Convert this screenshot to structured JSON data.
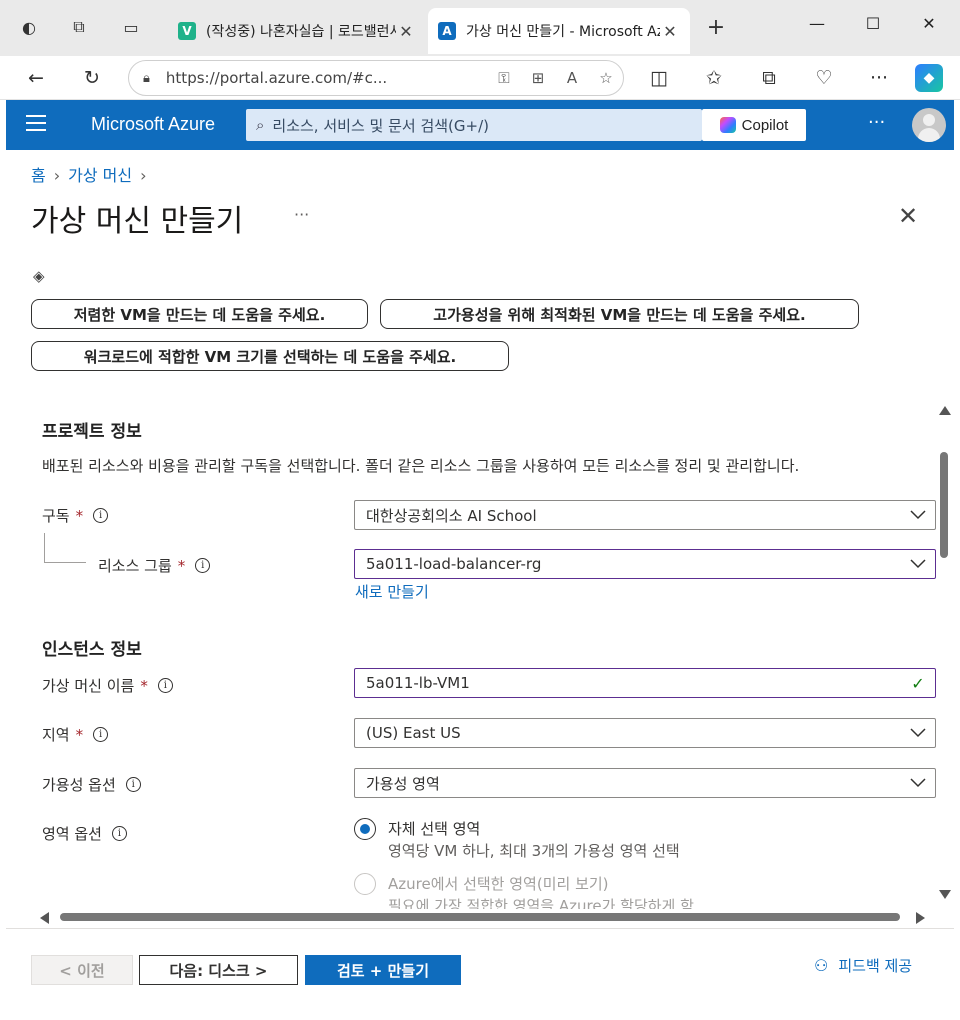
{
  "browser": {
    "tabs": [
      {
        "title": "(작성중) 나혼자실습 | 로드밸런서",
        "favicon": "V",
        "favicon_color": "#1fb28a",
        "active": false
      },
      {
        "title": "가상 머신 만들기 - Microsoft Azure",
        "favicon": "A",
        "favicon_color": "#0f6cbd",
        "active": true
      }
    ],
    "url": "https://portal.azure.com/#c...",
    "new_tab": "+",
    "controls": {
      "minimize": "—",
      "maximize": "☐",
      "close": "✕"
    }
  },
  "azure": {
    "brand": "Microsoft Azure",
    "search_placeholder": "리소스, 서비스 및 문서 검색(G+/)",
    "copilot_label": "Copilot",
    "more": "···"
  },
  "breadcrumb": [
    "홈",
    "가상 머신"
  ],
  "page": {
    "title": "가상 머신 만들기",
    "more": "···",
    "close": "✕"
  },
  "suggestions": [
    "저렴한 VM을 만드는 데 도움을 주세요.",
    "고가용성을 위해 최적화된 VM을 만드는 데 도움을 주세요.",
    "워크로드에 적합한 VM 크기를 선택하는 데 도움을 주세요."
  ],
  "project": {
    "heading": "프로젝트 정보",
    "description": "배포된 리소스와 비용을 관리할 구독을 선택합니다. 폴더 같은 리소스 그룹을 사용하여 모든 리소스를 정리 및 관리합니다.",
    "subscription_label": "구독",
    "subscription_value": "대한상공회의소 AI School",
    "resource_group_label": "리소스 그룹",
    "resource_group_value": "5a011-load-balancer-rg",
    "create_new": "새로 만들기"
  },
  "instance": {
    "heading": "인스턴스 정보",
    "vm_name_label": "가상 머신 이름",
    "vm_name_value": "5a011-lb-VM1",
    "region_label": "지역",
    "region_value": "(US) East US",
    "availability_label": "가용성 옵션",
    "availability_value": "가용성 영역",
    "zone_label": "영역 옵션",
    "zone_options": [
      {
        "title": "자체 선택 영역",
        "sub": "영역당 VM 하나, 최대 3개의 가용성 영역 선택",
        "selected": true
      },
      {
        "title": "Azure에서 선택한 영역(미리 보기)",
        "sub": "필요에 가장 적합한 영역을 Azure가 할당하게 함",
        "selected": false
      }
    ],
    "required_mark": "*",
    "info_mark": "i",
    "check_mark": "✓"
  },
  "footer": {
    "prev": "< 이전",
    "next": "다음: 디스크 >",
    "create": "검토 + 만들기",
    "feedback": "피드백 제공"
  }
}
